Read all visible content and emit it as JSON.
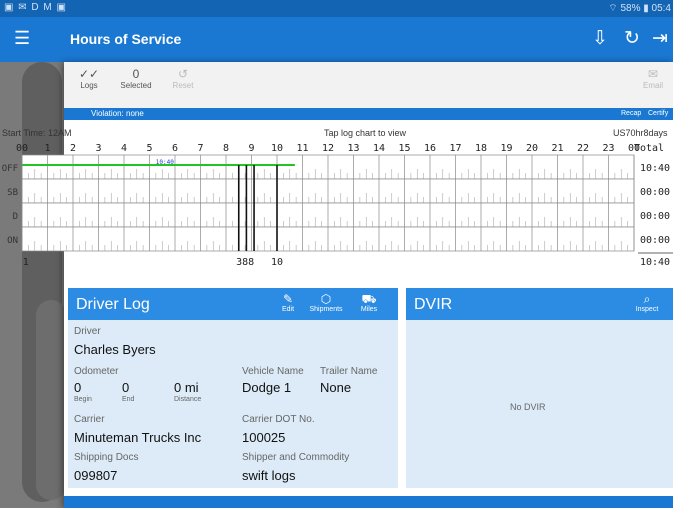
{
  "status": {
    "left": "▣ ✉ D M ▣",
    "right": "⌔ 58% ▮ 05:4"
  },
  "appbar": {
    "title": "Hours of Service"
  },
  "toolbar": {
    "logs_label": "Logs",
    "selected_count": "0",
    "selected_label": "Selected",
    "reset_label": "Reset",
    "email_label": "Email"
  },
  "violation": {
    "text": "Violation: none",
    "recap": "Recap",
    "certify": "Certify"
  },
  "chart": {
    "start_time": "Start Time: 12AM",
    "tap_hint": "Tap log chart to view",
    "ruleset": "US70hr8days",
    "hours": [
      "00",
      "1",
      "2",
      "3",
      "4",
      "5",
      "6",
      "7",
      "8",
      "9",
      "10",
      "11",
      "12",
      "13",
      "14",
      "15",
      "16",
      "17",
      "18",
      "19",
      "20",
      "21",
      "22",
      "23",
      "00"
    ],
    "total_label": "Total",
    "rows": [
      "OFF",
      "SB",
      "D",
      "ON"
    ],
    "totals": [
      "10:40",
      "00:00",
      "00:00",
      "00:00",
      "10:40"
    ],
    "marker": "10:40",
    "bottom_labels": [
      "1",
      "388",
      "10"
    ]
  },
  "driver_log": {
    "title": "Driver Log",
    "edit": "Edit",
    "shipments": "Shipments",
    "miles": "Miles",
    "driver_label": "Driver",
    "driver": "Charles Byers",
    "odometer_label": "Odometer",
    "odo_begin": "0",
    "odo_end": "0",
    "odo_distance": "0 mi",
    "begin_label": "Begin",
    "end_label": "End",
    "distance_label": "Distance",
    "vehicle_label": "Vehicle Name",
    "vehicle": "Dodge 1",
    "trailer_label": "Trailer Name",
    "trailer": "None",
    "carrier_label": "Carrier",
    "carrier": "Minuteman Trucks Inc",
    "dot_label": "Carrier DOT No.",
    "dot": "100025",
    "shipping_label": "Shipping Docs",
    "shipping": "099807",
    "shipper_label": "Shipper and Commodity",
    "shipper": "swift logs"
  },
  "dvir": {
    "title": "DVIR",
    "inspect": "Inspect",
    "empty": "No DVIR"
  },
  "colors": {
    "primary": "#1a78d2",
    "status": "#1464b4",
    "panel": "#dcebf7",
    "panel_head": "#2c8ce3",
    "duty_line": "#22c322"
  }
}
